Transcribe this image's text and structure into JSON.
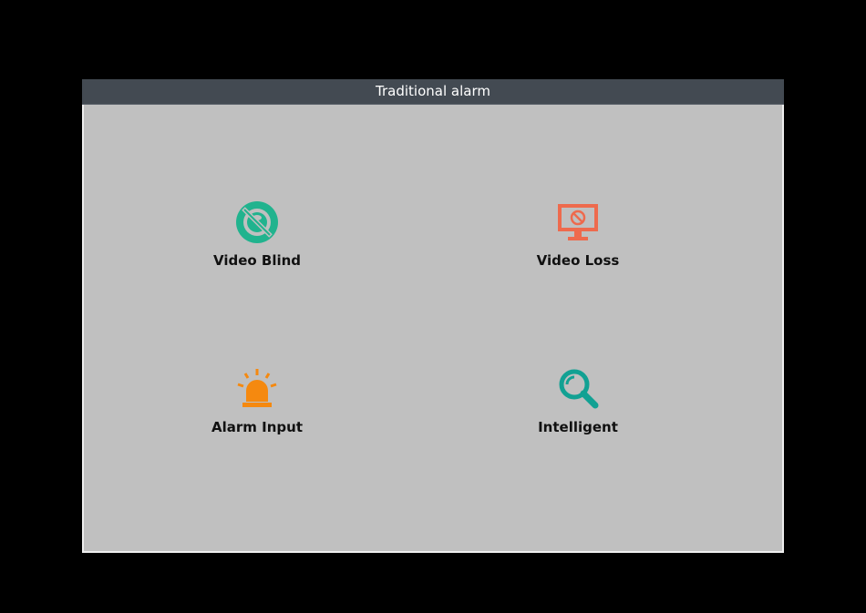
{
  "window": {
    "title": "Traditional alarm"
  },
  "tiles": [
    {
      "label": "Video Blind",
      "icon": "video-blind-icon",
      "color": "#21b38e"
    },
    {
      "label": "Video Loss",
      "icon": "video-loss-icon",
      "color": "#ee6a4d"
    },
    {
      "label": "Alarm Input",
      "icon": "alarm-siren-icon",
      "color": "#f5890f"
    },
    {
      "label": "Intelligent",
      "icon": "magnifier-icon",
      "color": "#12a193"
    }
  ],
  "colors": {
    "title_bar": "#434a52",
    "panel": "#c0c0c0",
    "backdrop": "#000000"
  }
}
